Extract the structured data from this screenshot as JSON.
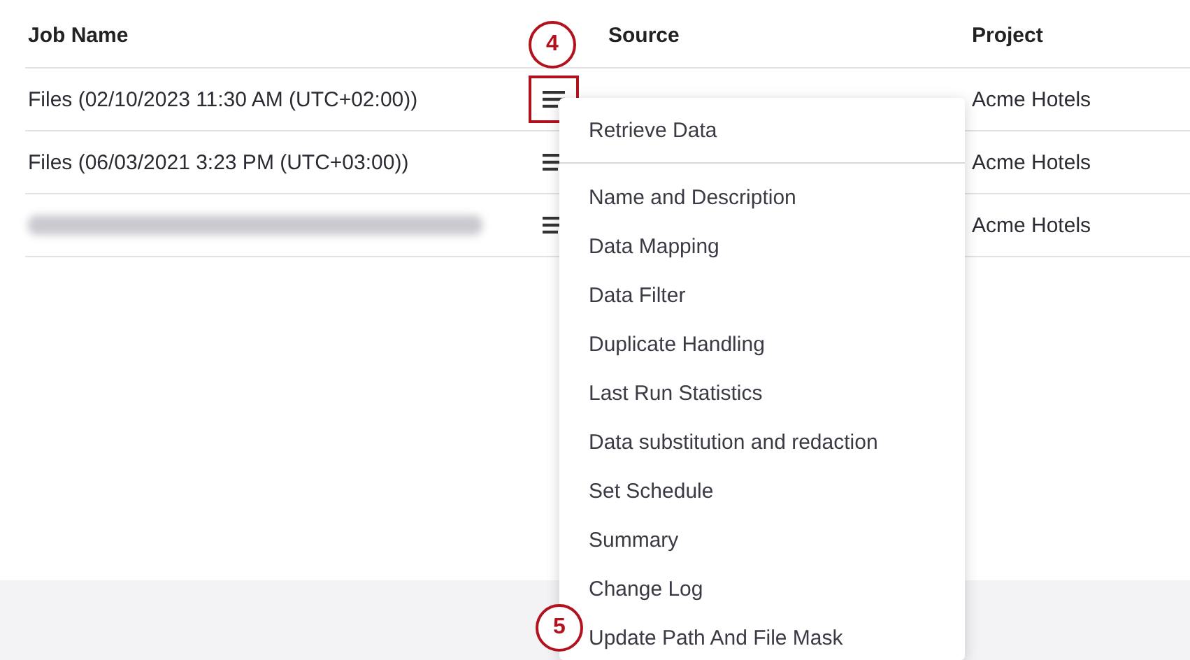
{
  "table": {
    "columns": [
      "Job Name",
      "",
      "Source",
      "Project"
    ],
    "rows": [
      {
        "kind": "text",
        "job_name": "Files (02/10/2023 11:30 AM (UTC+02:00))",
        "project": "Acme Hotels",
        "highlighted": true
      },
      {
        "kind": "text",
        "job_name": "Files (06/03/2021 3:23 PM (UTC+03:00))",
        "project": "Acme Hotels",
        "highlighted": false
      },
      {
        "kind": "redacted",
        "project": "Acme Hotels",
        "highlighted": false
      }
    ]
  },
  "menu": {
    "sections": [
      {
        "items": [
          "Retrieve Data"
        ]
      },
      {
        "items": [
          "Name and Description",
          "Data Mapping",
          "Data Filter",
          "Duplicate Handling",
          "Last Run Statistics",
          "Data substitution and redaction",
          "Set Schedule",
          "Summary",
          "Change Log",
          "Update Path And File Mask"
        ]
      }
    ]
  },
  "callouts": [
    {
      "number": "4"
    },
    {
      "number": "5"
    }
  ]
}
